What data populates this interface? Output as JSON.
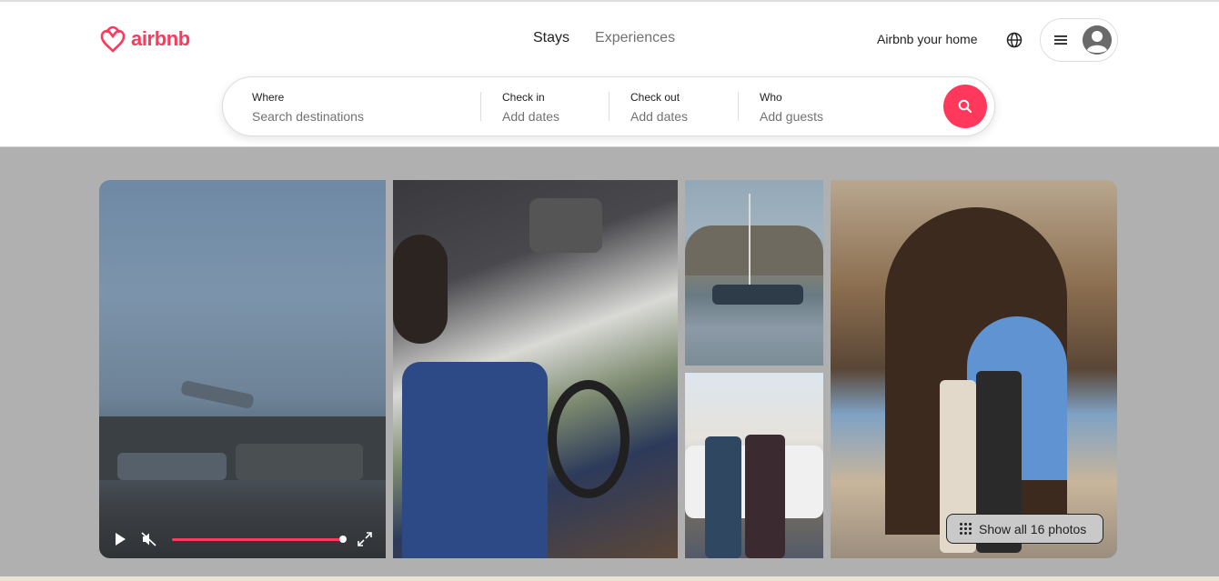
{
  "brand": {
    "name": "airbnb",
    "color": "#ff385c"
  },
  "nav": {
    "stays": "Stays",
    "experiences": "Experiences"
  },
  "header_actions": {
    "host_link": "Airbnb your home",
    "globe_icon": "globe-icon",
    "menu_icon": "hamburger-icon",
    "avatar_icon": "user-avatar-icon"
  },
  "search": {
    "where_label": "Where",
    "where_placeholder": "Search destinations",
    "checkin_label": "Check in",
    "checkin_placeholder": "Add dates",
    "checkout_label": "Check out",
    "checkout_placeholder": "Add dates",
    "who_label": "Who",
    "who_placeholder": "Add guests",
    "button_icon": "search-icon"
  },
  "gallery": {
    "video_controls": {
      "play_icon": "play-icon",
      "mute_icon": "mute-icon",
      "fullscreen_icon": "fullscreen-icon",
      "progress": 0.95
    },
    "show_all_label": "Show all 16 photos"
  }
}
